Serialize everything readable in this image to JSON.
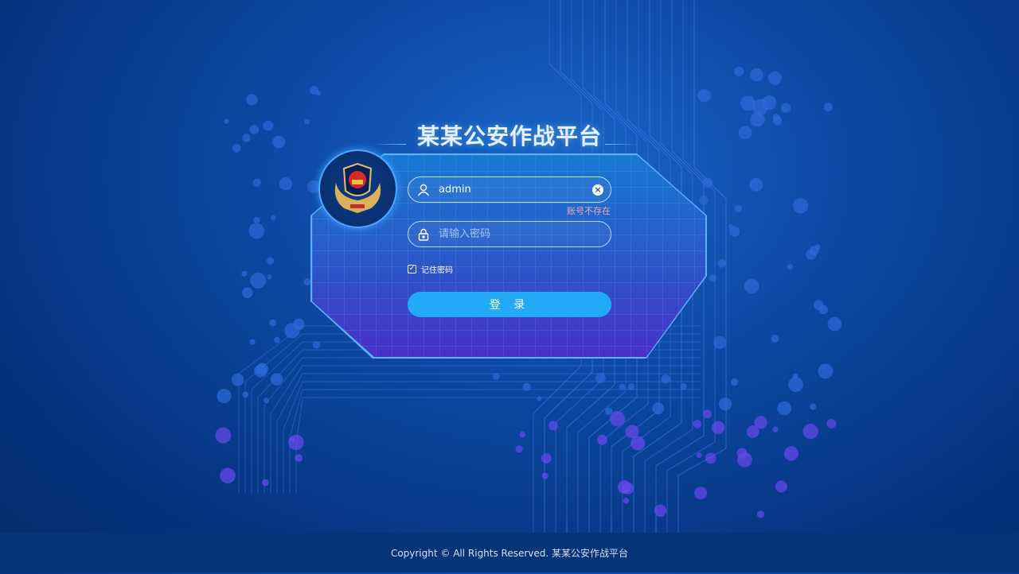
{
  "app": {
    "title": "某某公安作战平台"
  },
  "login": {
    "username_value": "admin",
    "username_error": "账号不存在",
    "password_placeholder": "请输入密码",
    "remember_label": "记住密码",
    "remember_checked": true,
    "submit_label": "登 录"
  },
  "footer": {
    "copyright": "Copyright © All Rights Reserved. 某某公安作战平台"
  },
  "colors": {
    "accent": "#22aaf6",
    "error": "#f4a6b8"
  }
}
